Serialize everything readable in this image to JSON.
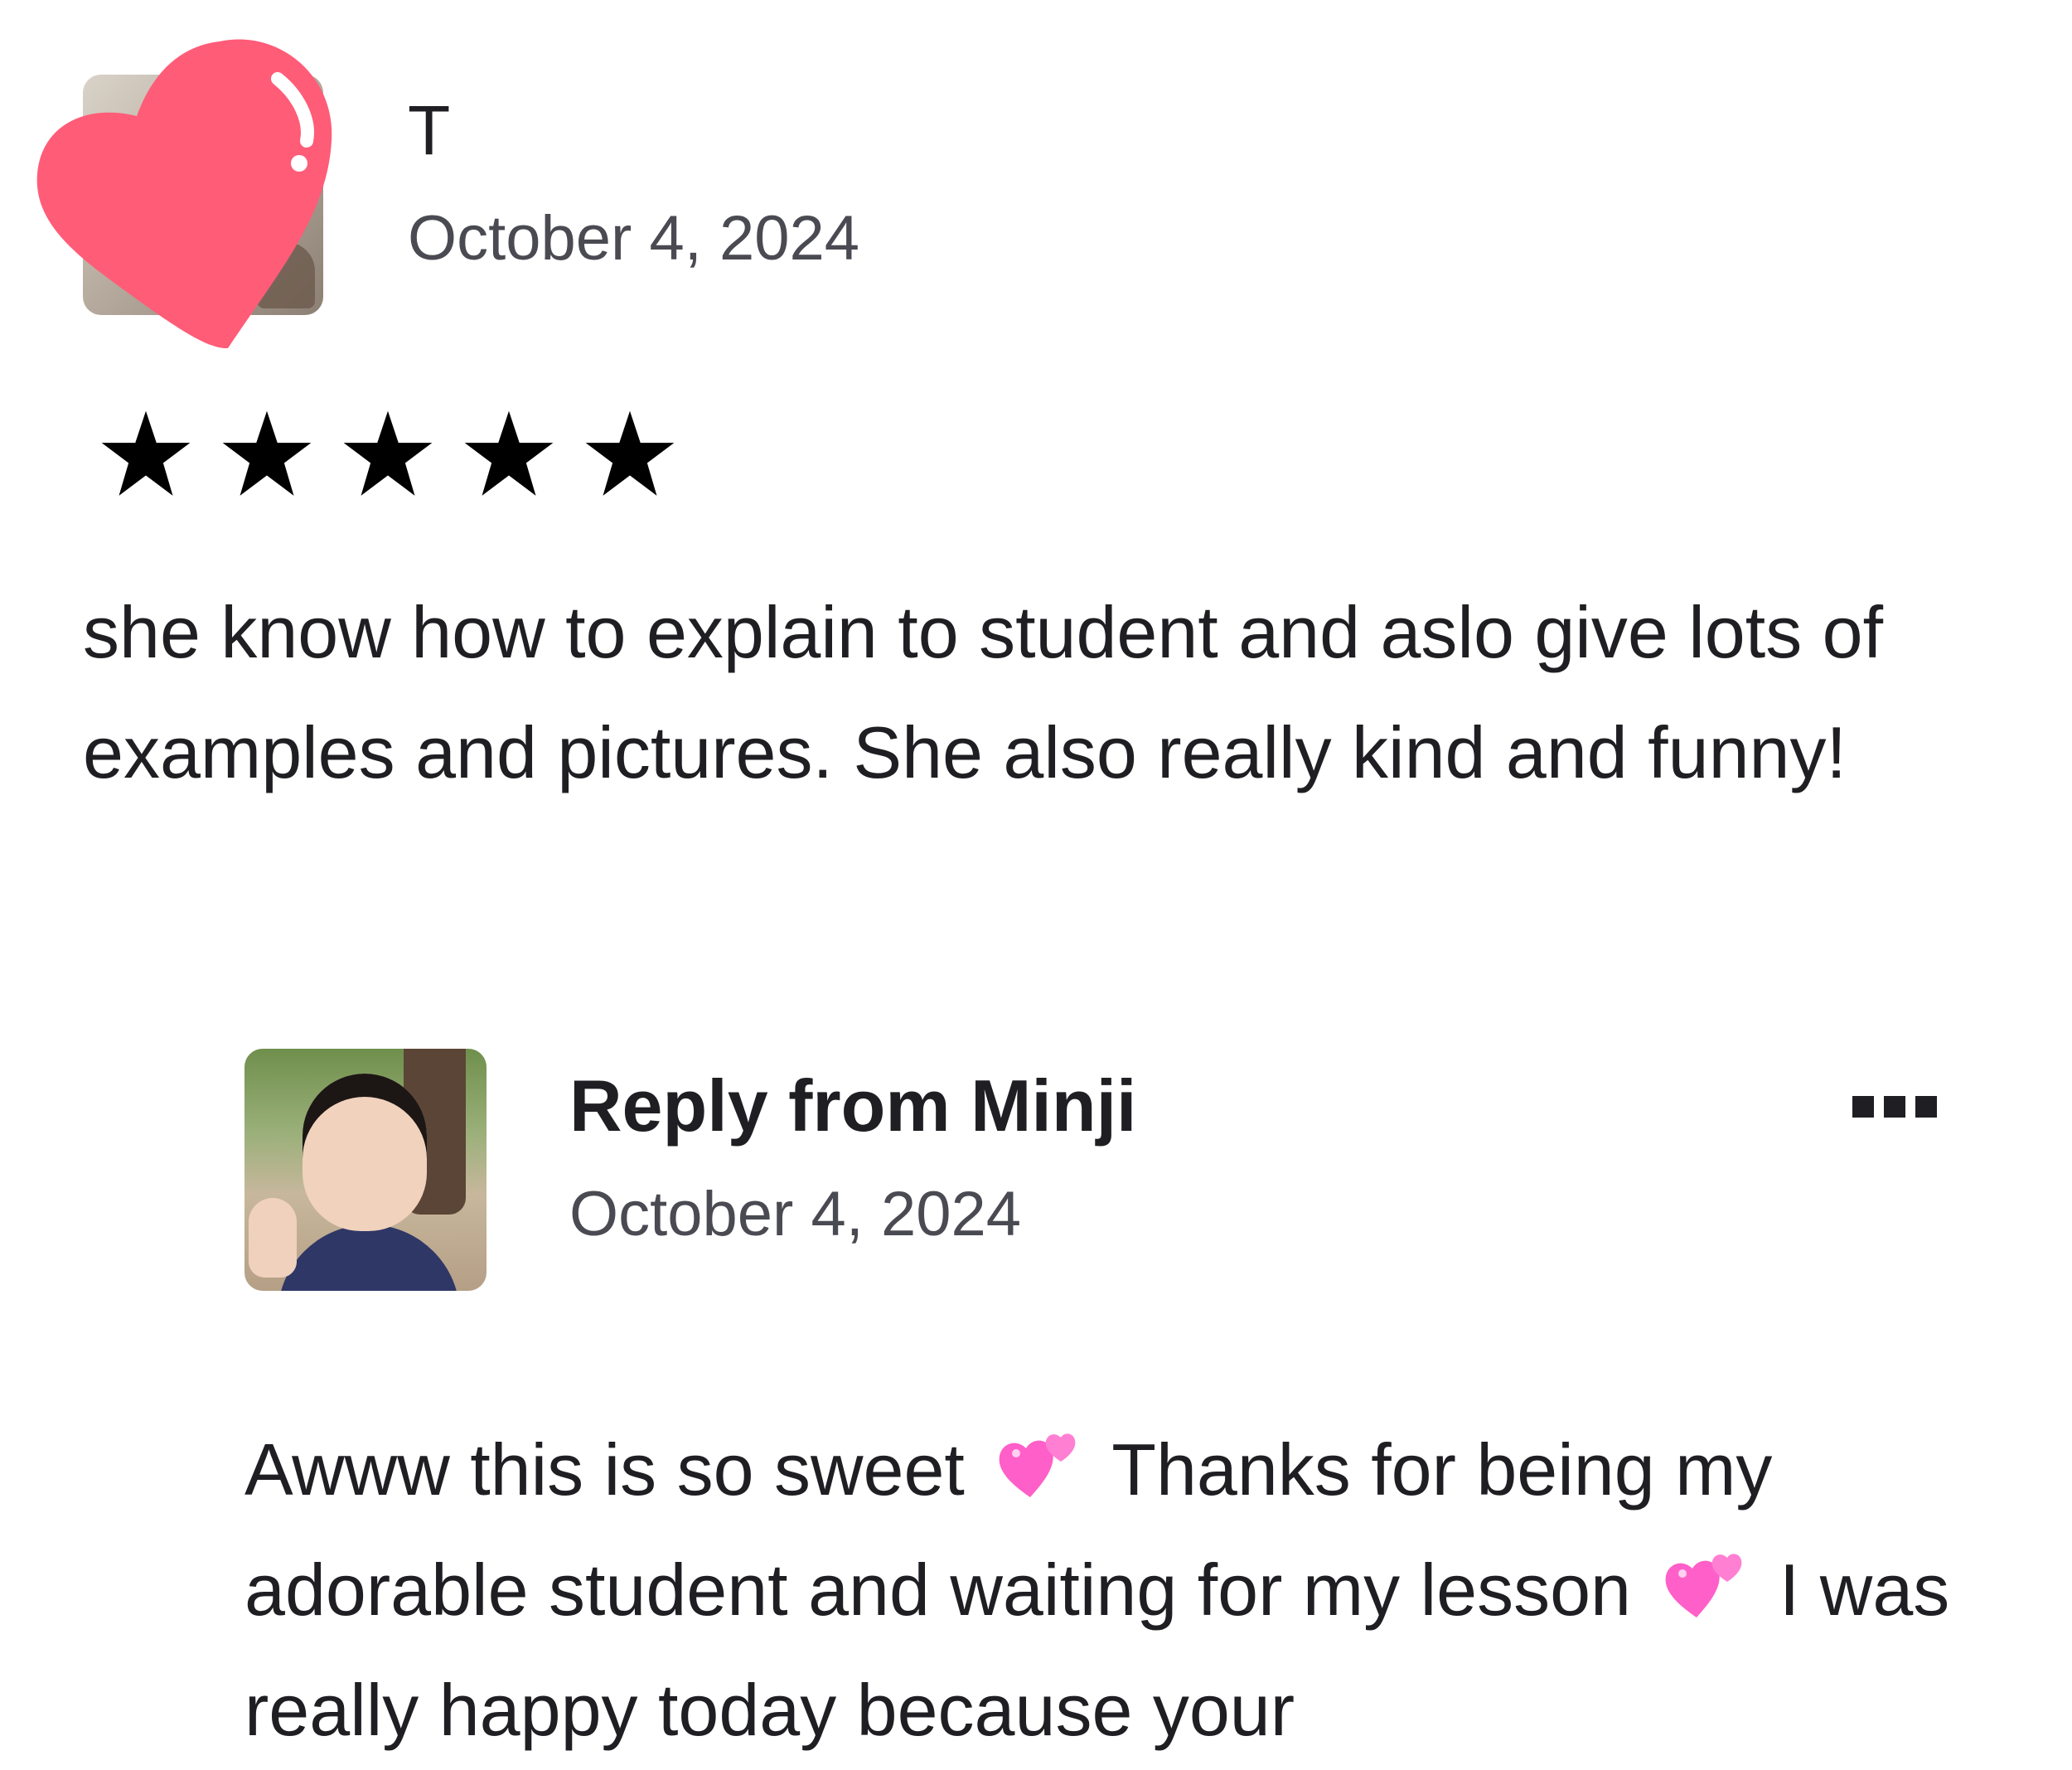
{
  "review": {
    "reviewer_name": "T",
    "date": "October 4, 2024",
    "rating": 5,
    "text": "she know how to explain to student and aslo give lots of examples and pictures. She also really kind and funny!"
  },
  "reply": {
    "title": "Reply from Minji",
    "date": "October 4, 2024",
    "text_part1": "Awww this is so sweet",
    "text_part2": "Thanks for being my adorable student and waiting for my lesson",
    "text_part3": "I was really happy today because your"
  },
  "icons": {
    "rating_star": "star-icon",
    "more": "more-icon",
    "sticker": "heart-sticker",
    "inline_emoji": "two-hearts-emoji"
  },
  "colors": {
    "heart_sticker": "#ff5c78",
    "emoji_pink": "#ff66cc",
    "text": "#1f1f23",
    "secondary_text": "#4a4a52"
  }
}
